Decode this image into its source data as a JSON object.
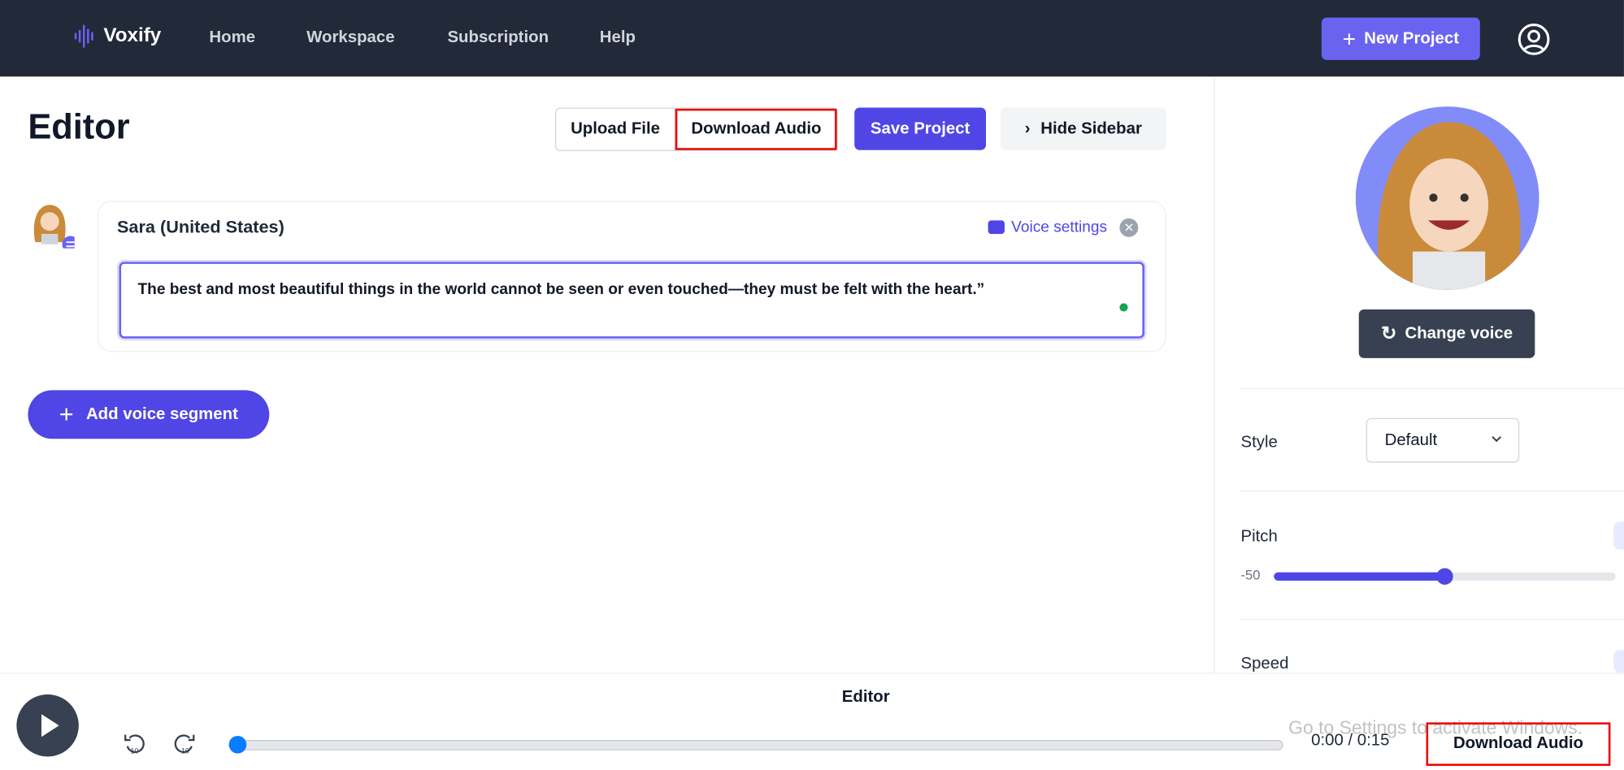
{
  "nav": {
    "brand": "Voxify",
    "links": [
      "Home",
      "Workspace",
      "Subscription",
      "Help"
    ],
    "new_project": "New Project"
  },
  "toolbar": {
    "title": "Editor",
    "upload": "Upload File",
    "download": "Download Audio",
    "save": "Save Project",
    "hide_sidebar": "Hide Sidebar"
  },
  "segment": {
    "voice_name": "Sara (United States)",
    "voice_settings": "Voice settings",
    "text": "The best and most beautiful things in the world cannot be seen or even touched—they must be felt with the heart.”"
  },
  "add_segment": "Add voice segment",
  "sidebar": {
    "change_voice": "Change voice",
    "style_label": "Style",
    "style_value": "Default",
    "pitch_label": "Pitch",
    "pitch_min": "-50",
    "pitch_fraction": 0.5,
    "speed_label": "Speed"
  },
  "player": {
    "title": "Editor",
    "time": "0:00 / 0:15",
    "progress": 0,
    "download": "Download Audio"
  },
  "watermark": "Go to Settings to activate Windows.",
  "colors": {
    "accent": "#4f46e5",
    "nav_bg": "#222938",
    "highlight": "#ee0000"
  }
}
